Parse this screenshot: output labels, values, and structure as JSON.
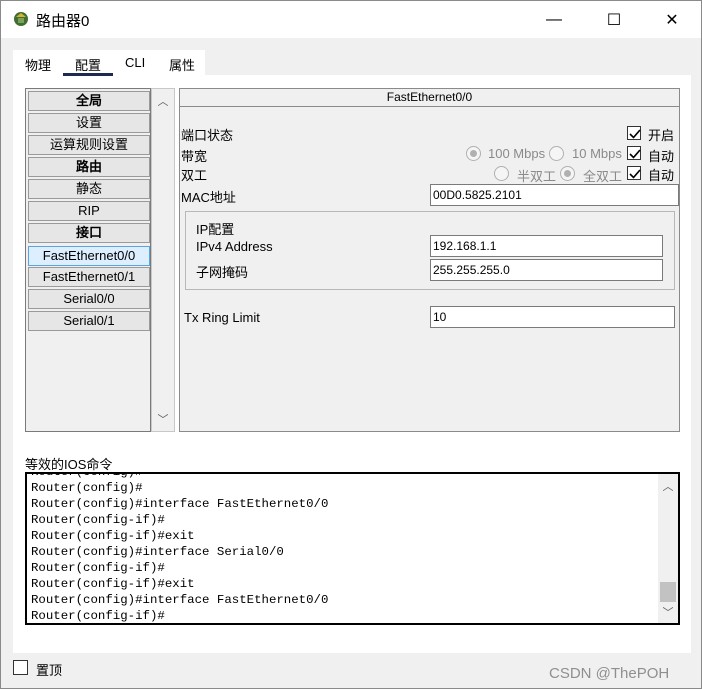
{
  "window": {
    "title": "路由器0",
    "minimize_glyph": "—",
    "maximize_glyph": "☐",
    "close_glyph": "✕"
  },
  "tabs": [
    "物理",
    "配置",
    "CLI",
    "属性"
  ],
  "active_tab": "配置",
  "sidebar": {
    "items": [
      {
        "label": "全局",
        "kind": "header"
      },
      {
        "label": "设置",
        "kind": "item"
      },
      {
        "label": "运算规则设置",
        "kind": "item"
      },
      {
        "label": "路由",
        "kind": "header"
      },
      {
        "label": "静态",
        "kind": "item"
      },
      {
        "label": "RIP",
        "kind": "item"
      },
      {
        "label": "接口",
        "kind": "header"
      },
      {
        "label": "FastEthernet0/0",
        "kind": "item",
        "selected": true
      },
      {
        "label": "FastEthernet0/1",
        "kind": "item"
      },
      {
        "label": "Serial0/0",
        "kind": "item"
      },
      {
        "label": "Serial0/1",
        "kind": "item"
      }
    ]
  },
  "panel": {
    "title": "FastEthernet0/0",
    "port_status_label": "端口状态",
    "port_on_label": "开启",
    "port_on_checked": true,
    "bandwidth_label": "带宽",
    "bandwidth_100": "100 Mbps",
    "bandwidth_10": "10 Mbps",
    "bandwidth_auto_label": "自动",
    "bandwidth_auto_checked": true,
    "duplex_label": "双工",
    "duplex_half": "半双工",
    "duplex_full": "全双工",
    "duplex_auto_label": "自动",
    "duplex_auto_checked": true,
    "mac_label": "MAC地址",
    "mac_value": "00D0.5825.2101",
    "ip_group_label": "IP配置",
    "ipv4_label": "IPv4 Address",
    "ipv4_value": "192.168.1.1",
    "mask_label": "子网掩码",
    "mask_value": "255.255.255.0",
    "tx_label": "Tx Ring Limit",
    "tx_value": "10"
  },
  "ios": {
    "label": "等效的IOS命令",
    "lines": [
      "Router(config)#",
      "Router(config)#interface FastEthernet0/0",
      "Router(config-if)#",
      "Router(config-if)#exit",
      "Router(config)#interface Serial0/0",
      "Router(config-if)#",
      "Router(config-if)#exit",
      "Router(config)#interface FastEthernet0/0",
      "Router(config-if)#"
    ]
  },
  "footer": {
    "pin_label": "置顶",
    "pin_checked": false,
    "watermark": "CSDN @ThePOH"
  },
  "colors": {
    "accent_tab": "#1d2a4d",
    "selected_item": "#ddeeff"
  }
}
